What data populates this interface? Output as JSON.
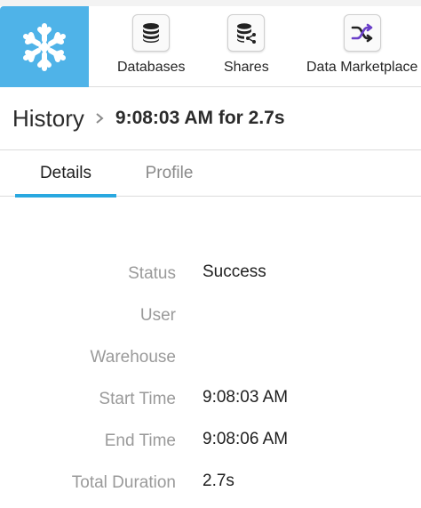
{
  "nav": {
    "items": [
      {
        "label": "Databases",
        "icon": "database-icon"
      },
      {
        "label": "Shares",
        "icon": "share-database-icon"
      },
      {
        "label": "Data Marketplace",
        "icon": "shuffle-icon"
      }
    ],
    "logo_color": "#4fb3e8",
    "accent_purple": "#6a3fc9"
  },
  "breadcrumb": {
    "root": "History",
    "current": "9:08:03 AM for 2.7s"
  },
  "tabs": [
    {
      "label": "Details",
      "active": true
    },
    {
      "label": "Profile",
      "active": false
    }
  ],
  "details": [
    {
      "label": "Status",
      "value": "Success"
    },
    {
      "label": "User",
      "value": ""
    },
    {
      "label": "Warehouse",
      "value": ""
    },
    {
      "label": "Start Time",
      "value": "9:08:03 AM"
    },
    {
      "label": "End Time",
      "value": "9:08:06 AM"
    },
    {
      "label": "Total Duration",
      "value": "2.7s"
    }
  ],
  "colors": {
    "tab_underline": "#29a8e0",
    "label_gray": "#9a9a9a"
  }
}
